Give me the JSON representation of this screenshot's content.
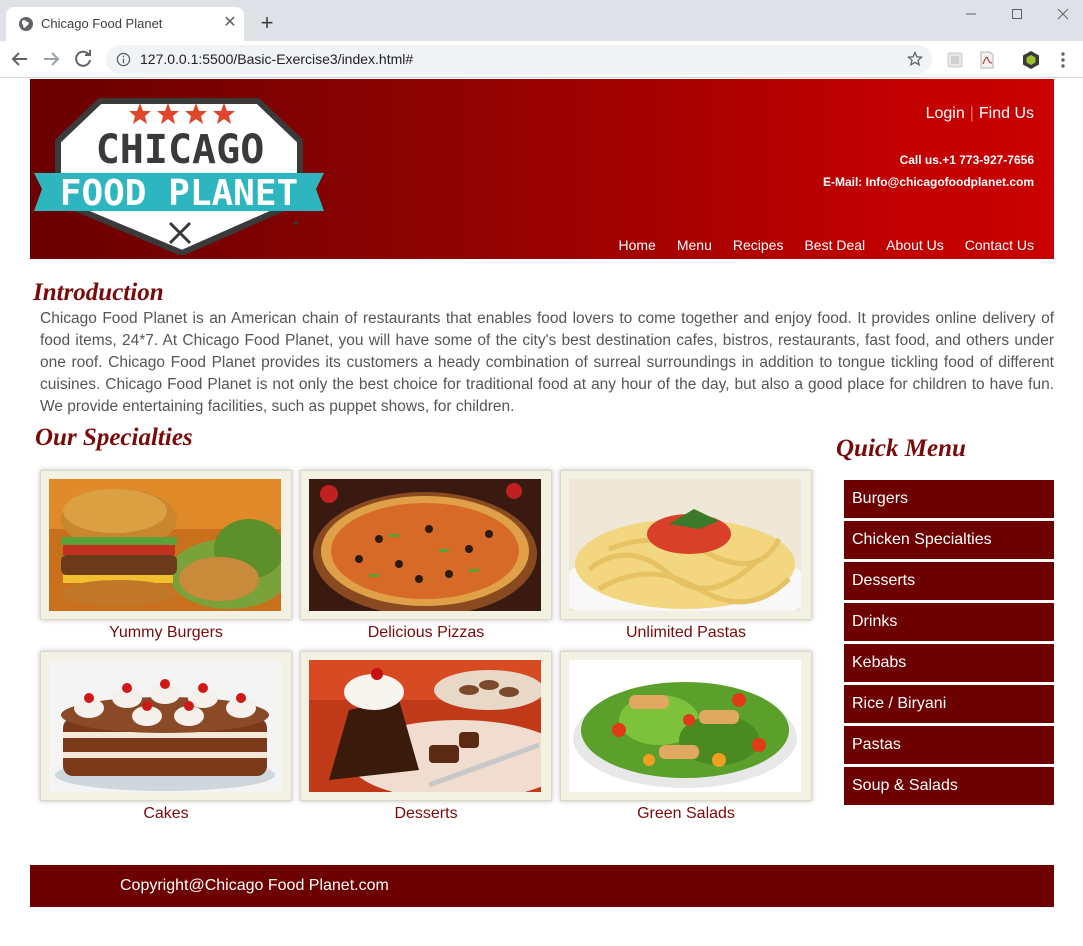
{
  "browser": {
    "tab_title": "Chicago Food Planet",
    "url": "127.0.0.1:5500/Basic-Exercise3/index.html#",
    "icons": [
      "globe-icon",
      "close-icon",
      "new-tab-icon",
      "minimize-icon",
      "maximize-icon",
      "window-close-icon",
      "back-icon",
      "forward-icon",
      "reload-icon",
      "info-icon",
      "star-icon",
      "extension-icon",
      "pdf-icon",
      "cube-extension-icon",
      "menu-dots-icon"
    ]
  },
  "header": {
    "logo_top": "CHICAGO",
    "logo_bottom": "FOOD PLANET",
    "login": "Login",
    "separator": "|",
    "find_us": "Find Us",
    "phone": "Call us.+1 773-927-7656",
    "email": "E-Mail: Info@chicagofoodplanet.com",
    "nav": [
      "Home",
      "Menu",
      "Recipes",
      "Best Deal",
      "About Us",
      "Contact Us"
    ]
  },
  "intro": {
    "heading": "Introduction",
    "text": "Chicago Food Planet is an American chain of restaurants that enables food lovers to come together and enjoy food. It provides online delivery of food items, 24*7. At Chicago Food Planet, you will have some of the city's best destination cafes, bistros, restaurants, fast food, and others under one roof. Chicago Food Planet provides its customers a heady combination of surreal surroundings in addition to tongue tickling food of different cuisines. Chicago Food Planet is not only the best choice for traditional food at any hour of the day, but also a good place for children to have fun. We provide entertaining facilities, such as puppet shows, for children."
  },
  "specialties": {
    "heading": "Our Specialties",
    "items": [
      "Yummy Burgers",
      "Delicious Pizzas",
      "Unlimited Pastas",
      "Cakes",
      "Desserts",
      "Green Salads"
    ]
  },
  "quick_menu": {
    "heading": "Quick Menu",
    "items": [
      "Burgers",
      "Chicken Specialties",
      "Desserts",
      "Drinks",
      "Kebabs",
      "Rice / Biryani",
      "Pastas",
      "Soup & Salads"
    ]
  },
  "footer": {
    "text": "Copyright@Chicago Food Planet.com"
  },
  "colors": {
    "brand_dark_red": "#6d0000",
    "header_red": "#c80000",
    "heading_maroon": "#7a0a0a",
    "logo_teal": "#2eb6c0",
    "star_red": "#e0462b"
  }
}
